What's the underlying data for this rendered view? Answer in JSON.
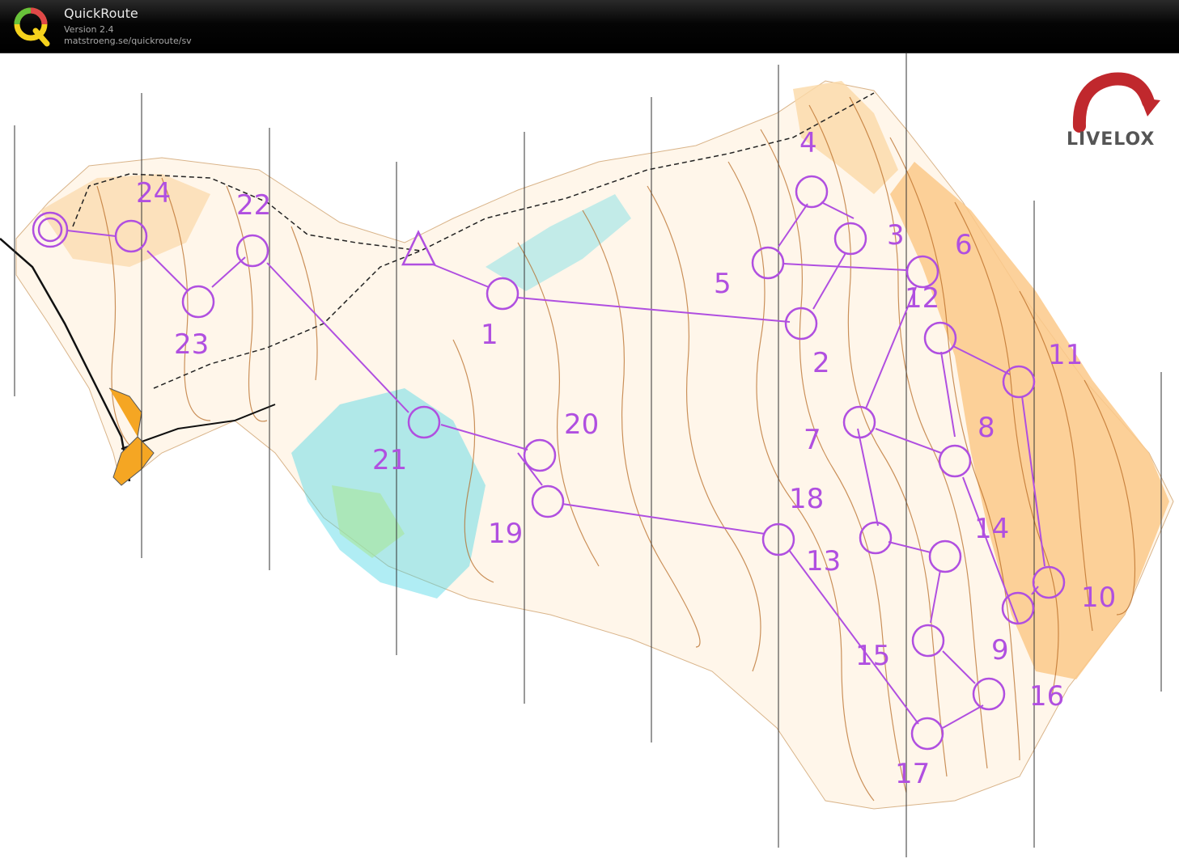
{
  "app": {
    "title": "QuickRoute",
    "version": "Version 2.4",
    "url": "matstroeng.se/quickroute/sv"
  },
  "branding": {
    "logo_text": "LIVELOX"
  },
  "colors": {
    "course": "#b04fe0",
    "terrain_open": "#fbc98a",
    "contour": "#b5651d",
    "water": "#4fd6e6",
    "vegetation": "#a8e69a",
    "titlebar": "#000000"
  },
  "course": {
    "start": {
      "label": "start-triangle"
    },
    "controls": [
      {
        "number": "1"
      },
      {
        "number": "2"
      },
      {
        "number": "3"
      },
      {
        "number": "4"
      },
      {
        "number": "5"
      },
      {
        "number": "6"
      },
      {
        "number": "7"
      },
      {
        "number": "8"
      },
      {
        "number": "9"
      },
      {
        "number": "10"
      },
      {
        "number": "11"
      },
      {
        "number": "12"
      },
      {
        "number": "13"
      },
      {
        "number": "14"
      },
      {
        "number": "15"
      },
      {
        "number": "16"
      },
      {
        "number": "17"
      },
      {
        "number": "18"
      },
      {
        "number": "19"
      },
      {
        "number": "20"
      },
      {
        "number": "21"
      },
      {
        "number": "22"
      },
      {
        "number": "23"
      },
      {
        "number": "24"
      }
    ],
    "finish": {
      "label": "finish-double-circle"
    }
  }
}
